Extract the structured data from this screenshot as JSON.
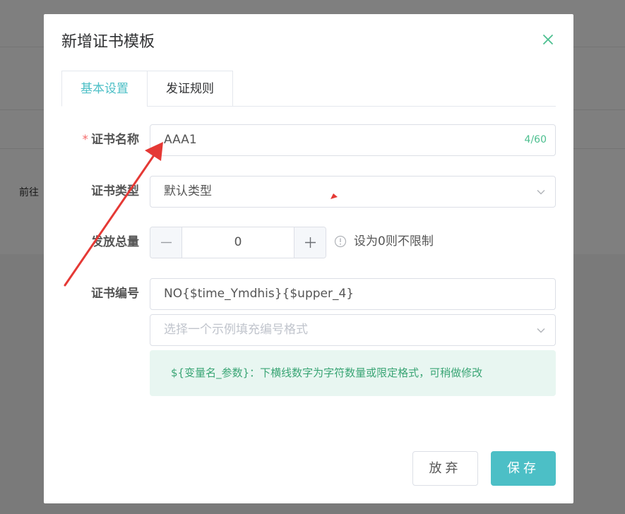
{
  "background": {
    "side_text": "前往"
  },
  "dialog": {
    "title": "新增证书模板",
    "tabs": [
      {
        "label": "基本设置",
        "active": true
      },
      {
        "label": "发证规则",
        "active": false
      }
    ],
    "fields": {
      "name": {
        "label": "证书名称",
        "required": true,
        "value": "AAA1",
        "count": "4/60"
      },
      "type": {
        "label": "证书类型",
        "value": "默认类型"
      },
      "quantity": {
        "label": "发放总量",
        "value": "0",
        "hint": "设为0则不限制"
      },
      "code": {
        "label": "证书编号",
        "value": "NO{$time_Ymdhis}{$upper_4}",
        "example_placeholder": "选择一个示例填充编号格式",
        "tip": "${变量名_参数}：下横线数字为字符数量或限定格式，可稍做修改"
      }
    },
    "buttons": {
      "cancel": "放弃",
      "save": "保存"
    }
  },
  "colors": {
    "accent": "#4cbfc6",
    "tip_bg": "#e8f6f1",
    "tip_text": "#3aa575",
    "required": "#f56c6c",
    "annotation": "#e53935"
  },
  "icons": {
    "close": "close-icon",
    "chevron": "chevron-down-icon",
    "minus": "minus-icon",
    "plus": "plus-icon",
    "info": "info-circle-icon"
  }
}
